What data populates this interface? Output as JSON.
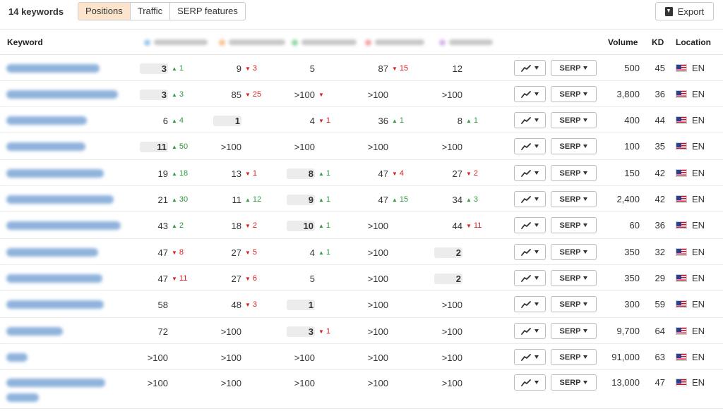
{
  "toolbar": {
    "keyword_count": "14 keywords",
    "tabs": [
      "Positions",
      "Traffic",
      "SERP features"
    ],
    "active_tab": "Positions",
    "export_label": "Export"
  },
  "table": {
    "headers": {
      "keyword": "Keyword",
      "volume": "Volume",
      "kd": "KD",
      "location": "Location"
    },
    "serp_label": "SERP",
    "competitor_colors": [
      "#9cc7ef",
      "#f9c28f",
      "#93d6a2",
      "#f4a3a3",
      "#d7b4ec"
    ],
    "rows": [
      {
        "pos": [
          {
            "v": "3",
            "b": true,
            "d": "up",
            "c": "1"
          },
          {
            "v": "9",
            "d": "down",
            "c": "3"
          },
          {
            "v": "5"
          },
          {
            "v": "87",
            "d": "down",
            "c": "15"
          },
          {
            "v": "12"
          }
        ],
        "volume": "500",
        "kd": "45",
        "loc": "EN"
      },
      {
        "pos": [
          {
            "v": "3",
            "b": true,
            "d": "up",
            "c": "3"
          },
          {
            "v": "85",
            "d": "down",
            "c": "25"
          },
          {
            "v": ">100",
            "d": "down",
            "c": ""
          },
          {
            "v": ">100"
          },
          {
            "v": ">100"
          }
        ],
        "volume": "3,800",
        "kd": "36",
        "loc": "EN"
      },
      {
        "pos": [
          {
            "v": "6",
            "d": "up",
            "c": "4"
          },
          {
            "v": "1",
            "b": true
          },
          {
            "v": "4",
            "d": "down",
            "c": "1"
          },
          {
            "v": "36",
            "d": "up",
            "c": "1"
          },
          {
            "v": "8",
            "d": "up",
            "c": "1"
          }
        ],
        "volume": "400",
        "kd": "44",
        "loc": "EN"
      },
      {
        "pos": [
          {
            "v": "11",
            "b": true,
            "d": "up",
            "c": "50"
          },
          {
            "v": ">100"
          },
          {
            "v": ">100"
          },
          {
            "v": ">100"
          },
          {
            "v": ">100"
          }
        ],
        "volume": "100",
        "kd": "35",
        "loc": "EN"
      },
      {
        "pos": [
          {
            "v": "19",
            "d": "up",
            "c": "18"
          },
          {
            "v": "13",
            "d": "down",
            "c": "1"
          },
          {
            "v": "8",
            "b": true,
            "d": "up",
            "c": "1"
          },
          {
            "v": "47",
            "d": "down",
            "c": "4"
          },
          {
            "v": "27",
            "d": "down",
            "c": "2"
          }
        ],
        "volume": "150",
        "kd": "42",
        "loc": "EN"
      },
      {
        "pos": [
          {
            "v": "21",
            "d": "up",
            "c": "30"
          },
          {
            "v": "11",
            "d": "up",
            "c": "12"
          },
          {
            "v": "9",
            "b": true,
            "d": "up",
            "c": "1"
          },
          {
            "v": "47",
            "d": "up",
            "c": "15"
          },
          {
            "v": "34",
            "d": "up",
            "c": "3"
          }
        ],
        "volume": "2,400",
        "kd": "42",
        "loc": "EN"
      },
      {
        "pos": [
          {
            "v": "43",
            "d": "up",
            "c": "2"
          },
          {
            "v": "18",
            "d": "down",
            "c": "2"
          },
          {
            "v": "10",
            "b": true,
            "d": "up",
            "c": "1"
          },
          {
            "v": ">100"
          },
          {
            "v": "44",
            "d": "down",
            "c": "11"
          }
        ],
        "volume": "60",
        "kd": "36",
        "loc": "EN"
      },
      {
        "pos": [
          {
            "v": "47",
            "d": "down",
            "c": "8"
          },
          {
            "v": "27",
            "d": "down",
            "c": "5"
          },
          {
            "v": "4",
            "d": "up",
            "c": "1"
          },
          {
            "v": ">100"
          },
          {
            "v": "2",
            "b": true
          }
        ],
        "volume": "350",
        "kd": "32",
        "loc": "EN"
      },
      {
        "pos": [
          {
            "v": "47",
            "d": "down",
            "c": "11"
          },
          {
            "v": "27",
            "d": "down",
            "c": "6"
          },
          {
            "v": "5"
          },
          {
            "v": ">100"
          },
          {
            "v": "2",
            "b": true
          }
        ],
        "volume": "350",
        "kd": "29",
        "loc": "EN"
      },
      {
        "pos": [
          {
            "v": "58"
          },
          {
            "v": "48",
            "d": "down",
            "c": "3"
          },
          {
            "v": "1",
            "b": true
          },
          {
            "v": ">100"
          },
          {
            "v": ">100"
          }
        ],
        "volume": "300",
        "kd": "59",
        "loc": "EN"
      },
      {
        "pos": [
          {
            "v": "72"
          },
          {
            "v": ">100"
          },
          {
            "v": "3",
            "b": true,
            "d": "down",
            "c": "1"
          },
          {
            "v": ">100"
          },
          {
            "v": ">100"
          }
        ],
        "volume": "9,700",
        "kd": "64",
        "loc": "EN"
      },
      {
        "pos": [
          {
            "v": ">100"
          },
          {
            "v": ">100"
          },
          {
            "v": ">100"
          },
          {
            "v": ">100"
          },
          {
            "v": ">100"
          }
        ],
        "volume": "91,000",
        "kd": "63",
        "loc": "EN"
      },
      {
        "pos": [
          {
            "v": ">100"
          },
          {
            "v": ">100"
          },
          {
            "v": ">100"
          },
          {
            "v": ">100"
          },
          {
            "v": ">100"
          }
        ],
        "volume": "13,000",
        "kd": "47",
        "loc": "EN"
      }
    ]
  }
}
